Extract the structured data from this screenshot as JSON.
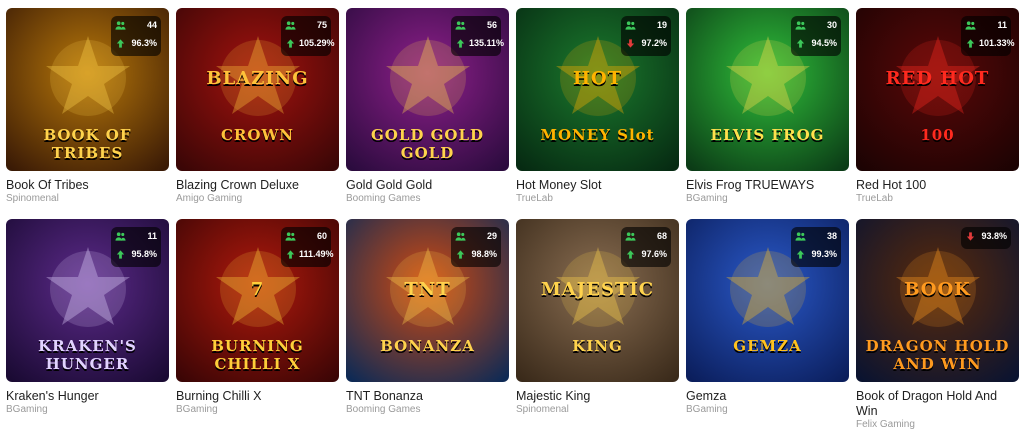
{
  "games": [
    {
      "title": "Book Of Tribes",
      "provider": "Spinomenal",
      "players": "44",
      "rtp": "96.3%",
      "rtp_trend": "up",
      "art": {
        "bg1": "#3a1a05",
        "bg2": "#b8780a",
        "accent": "#ffd34d",
        "label_top": "",
        "label_bottom": "BOOK OF TRIBES"
      }
    },
    {
      "title": "Blazing Crown Deluxe",
      "provider": "Amigo Gaming",
      "players": "75",
      "rtp": "105.29%",
      "rtp_trend": "up",
      "art": {
        "bg1": "#3a0606",
        "bg2": "#a3120e",
        "accent": "#ffc23a",
        "label_top": "BLAZING",
        "label_bottom": "CROWN"
      }
    },
    {
      "title": "Gold Gold Gold",
      "provider": "Booming Games",
      "players": "56",
      "rtp": "135.11%",
      "rtp_trend": "up",
      "art": {
        "bg1": "#2b0b3e",
        "bg2": "#8e1f8a",
        "accent": "#ffd34d",
        "label_top": "",
        "label_bottom": "GOLD GOLD GOLD"
      }
    },
    {
      "title": "Hot Money Slot",
      "provider": "TrueLab",
      "players": "19",
      "rtp": "97.2%",
      "rtp_trend": "down",
      "art": {
        "bg1": "#062a12",
        "bg2": "#1b7a2d",
        "accent": "#ffb300",
        "label_top": "HOT",
        "label_bottom": "MONEY Slot"
      }
    },
    {
      "title": "Elvis Frog TRUEWAYS",
      "provider": "BGaming",
      "players": "30",
      "rtp": "94.5%",
      "rtp_trend": "up",
      "art": {
        "bg1": "#0b3b16",
        "bg2": "#2fbf3a",
        "accent": "#ffe14d",
        "label_top": "",
        "label_bottom": "ELVIS FROG"
      }
    },
    {
      "title": "Red Hot 100",
      "provider": "TrueLab",
      "players": "11",
      "rtp": "101.33%",
      "rtp_trend": "up",
      "art": {
        "bg1": "#1c0303",
        "bg2": "#5a0808",
        "accent": "#ff2a1f",
        "label_top": "RED HOT",
        "label_bottom": "100"
      }
    },
    {
      "title": "Kraken's Hunger",
      "provider": "BGaming",
      "players": "11",
      "rtp": "95.8%",
      "rtp_trend": "up",
      "art": {
        "bg1": "#1a0a33",
        "bg2": "#5c2a8a",
        "accent": "#e2d3ff",
        "label_top": "",
        "label_bottom": "KRAKEN'S HUNGER"
      }
    },
    {
      "title": "Burning Chilli X",
      "provider": "BGaming",
      "players": "60",
      "rtp": "111.49%",
      "rtp_trend": "up",
      "art": {
        "bg1": "#3b0505",
        "bg2": "#b0190c",
        "accent": "#ffcf3a",
        "label_top": "7",
        "label_bottom": "BURNING CHILLI X"
      }
    },
    {
      "title": "TNT Bonanza",
      "provider": "Booming Games",
      "players": "29",
      "rtp": "98.8%",
      "rtp_trend": "up",
      "art": {
        "bg1": "#0e2a55",
        "bg2": "#d24a10",
        "accent": "#ffd24d",
        "label_top": "TNT",
        "label_bottom": "BONANZA"
      }
    },
    {
      "title": "Majestic King",
      "provider": "Spinomenal",
      "players": "68",
      "rtp": "97.6%",
      "rtp_trend": "up",
      "art": {
        "bg1": "#3a2a1a",
        "bg2": "#8a6e52",
        "accent": "#ffd34d",
        "label_top": "MAJESTIC",
        "label_bottom": "KING"
      }
    },
    {
      "title": "Gemza",
      "provider": "BGaming",
      "players": "38",
      "rtp": "99.3%",
      "rtp_trend": "up",
      "art": {
        "bg1": "#0b1e5c",
        "bg2": "#2a59c9",
        "accent": "#ffc21f",
        "label_top": "",
        "label_bottom": "GEMZA"
      }
    },
    {
      "title": "Book of Dragon Hold And Win",
      "provider": "Felix Gaming",
      "players": "",
      "rtp": "93.8%",
      "rtp_trend": "down",
      "art": {
        "bg1": "#0a1330",
        "bg2": "#5a2a0a",
        "accent": "#ff9a1f",
        "label_top": "BOOK",
        "label_bottom": "DRAGON HOLD AND WIN"
      }
    }
  ],
  "colors": {
    "players_icon": "#3cc85a",
    "rtp_up": "#3cc85a",
    "rtp_down": "#e23b3b"
  },
  "icons": {
    "players": "people-icon",
    "rtp": "rtp-arrow-icon"
  }
}
